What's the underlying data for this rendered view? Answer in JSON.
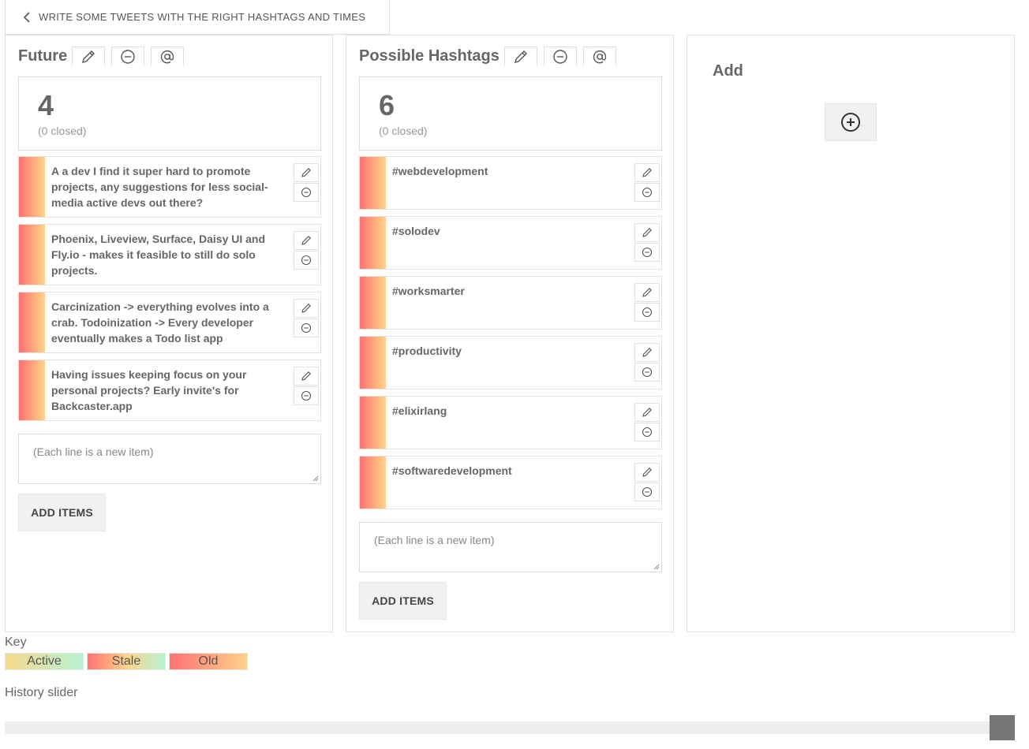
{
  "nav": {
    "back_label": "WRITE SOME TWEETS WITH THE RIGHT HASHTAGS AND TIMES"
  },
  "columns": {
    "future": {
      "title": "Future",
      "count": "4",
      "closed": "(0 closed)",
      "items": [
        "A a dev I find it super hard to promote projects, any suggestions for less social-media active devs out there?",
        "Phoenix, Liveview, Surface, Daisy UI and Fly.io - makes it feasible to still do solo projects.",
        "Carcinization -> everything evolves into a crab. Todoinization -> Every developer eventually makes a Todo list app",
        "Having issues keeping focus on your personal projects? Early invite's for Backcaster.app"
      ],
      "input_placeholder": "(Each line is a new item)",
      "add_button": "ADD ITEMS"
    },
    "hashtags": {
      "title": "Possible Hashtags",
      "count": "6",
      "closed": "(0 closed)",
      "items": [
        "#webdevelopment",
        "#solodev",
        "#worksmarter",
        "#productivity",
        "#elixirlang",
        "#softwaredevelopment"
      ],
      "input_placeholder": "(Each line is a new item)",
      "add_button": "ADD ITEMS"
    },
    "add": {
      "title": "Add"
    }
  },
  "key": {
    "label": "Key",
    "entries": [
      "Active",
      "Stale",
      "Old"
    ]
  },
  "history": {
    "label": "History slider",
    "value": 1.0
  },
  "colors": {
    "stale_start": "#ff7272",
    "stale_end": "#ffd38a",
    "active_start": "#f9d98b",
    "active_end": "#b6f2d4",
    "slider_thumb": "#777777"
  },
  "icons": [
    "chevron-left-icon",
    "pencil-icon",
    "minus-circle-icon",
    "at-sign-icon",
    "plus-circle-icon",
    "resize-grip-icon"
  ]
}
